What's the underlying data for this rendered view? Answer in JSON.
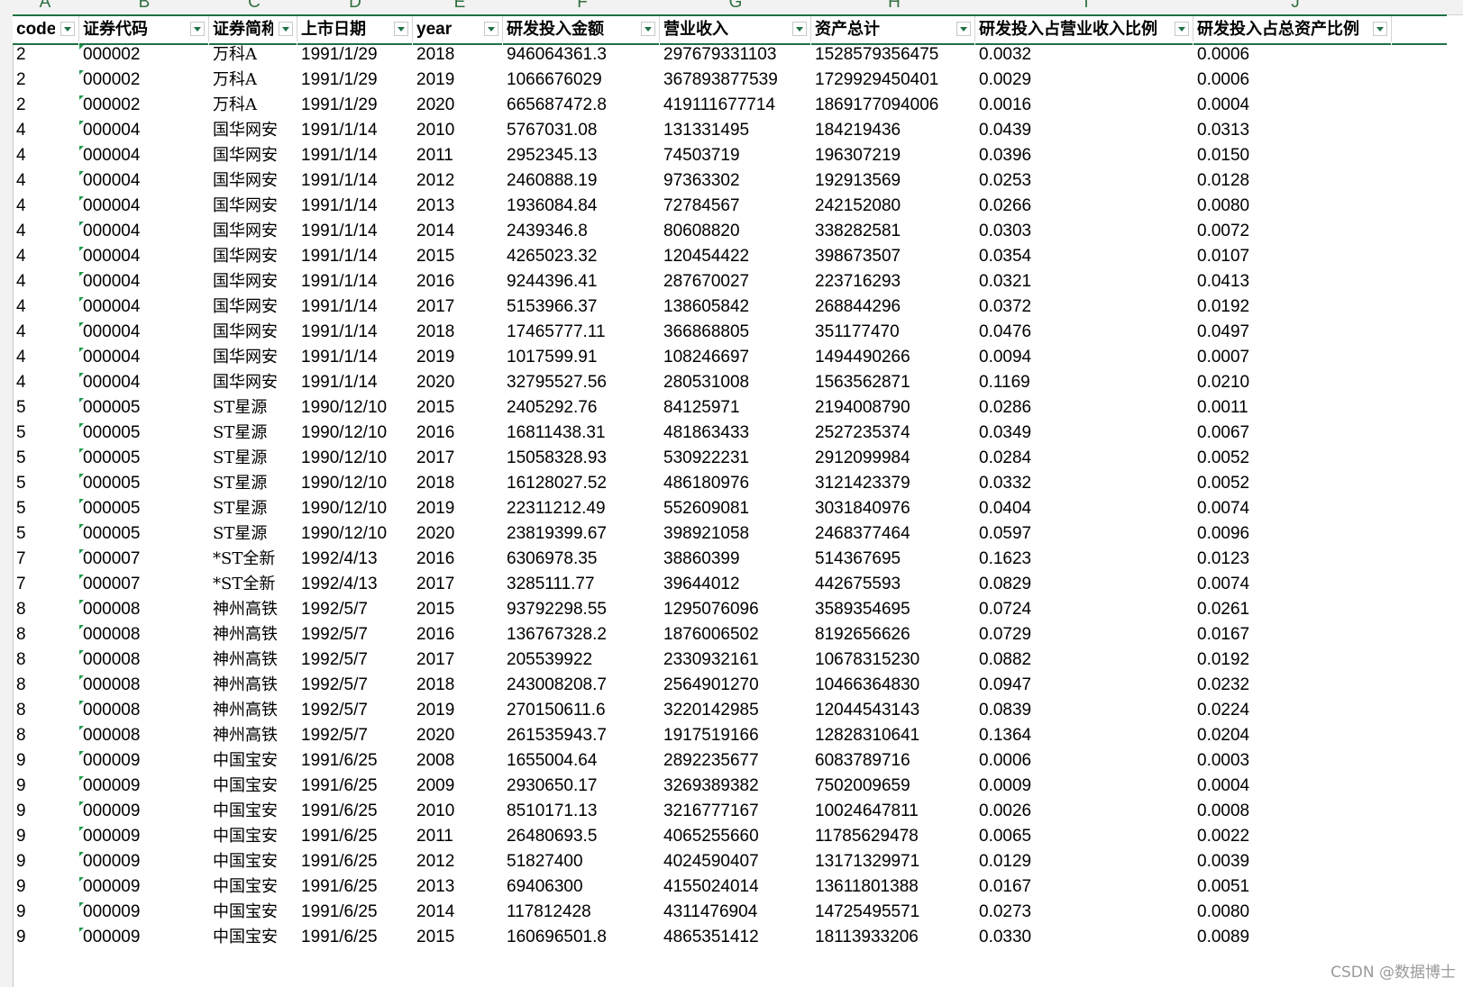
{
  "column_letters": [
    "A",
    "B",
    "C",
    "D",
    "E",
    "F",
    "G",
    "H",
    "I",
    "J"
  ],
  "headers": [
    "code",
    "证券代码",
    "证券简称",
    "上市日期",
    "year",
    "研发投入金额",
    "营业收入",
    "资产总计",
    "研发投入占营业收入比例",
    "研发投入占总资产比例"
  ],
  "rows": [
    [
      "2",
      "000002",
      "万科A",
      "1991/1/29",
      "2018",
      "946064361.3",
      "297679331103",
      "1528579356475",
      "0.0032",
      "0.0006"
    ],
    [
      "2",
      "000002",
      "万科A",
      "1991/1/29",
      "2019",
      "1066676029",
      "367893877539",
      "1729929450401",
      "0.0029",
      "0.0006"
    ],
    [
      "2",
      "000002",
      "万科A",
      "1991/1/29",
      "2020",
      "665687472.8",
      "419111677714",
      "1869177094006",
      "0.0016",
      "0.0004"
    ],
    [
      "4",
      "000004",
      "国华网安",
      "1991/1/14",
      "2010",
      "5767031.08",
      "131331495",
      "184219436",
      "0.0439",
      "0.0313"
    ],
    [
      "4",
      "000004",
      "国华网安",
      "1991/1/14",
      "2011",
      "2952345.13",
      "74503719",
      "196307219",
      "0.0396",
      "0.0150"
    ],
    [
      "4",
      "000004",
      "国华网安",
      "1991/1/14",
      "2012",
      "2460888.19",
      "97363302",
      "192913569",
      "0.0253",
      "0.0128"
    ],
    [
      "4",
      "000004",
      "国华网安",
      "1991/1/14",
      "2013",
      "1936084.84",
      "72784567",
      "242152080",
      "0.0266",
      "0.0080"
    ],
    [
      "4",
      "000004",
      "国华网安",
      "1991/1/14",
      "2014",
      "2439346.8",
      "80608820",
      "338282581",
      "0.0303",
      "0.0072"
    ],
    [
      "4",
      "000004",
      "国华网安",
      "1991/1/14",
      "2015",
      "4265023.32",
      "120454422",
      "398673507",
      "0.0354",
      "0.0107"
    ],
    [
      "4",
      "000004",
      "国华网安",
      "1991/1/14",
      "2016",
      "9244396.41",
      "287670027",
      "223716293",
      "0.0321",
      "0.0413"
    ],
    [
      "4",
      "000004",
      "国华网安",
      "1991/1/14",
      "2017",
      "5153966.37",
      "138605842",
      "268844296",
      "0.0372",
      "0.0192"
    ],
    [
      "4",
      "000004",
      "国华网安",
      "1991/1/14",
      "2018",
      "17465777.11",
      "366868805",
      "351177470",
      "0.0476",
      "0.0497"
    ],
    [
      "4",
      "000004",
      "国华网安",
      "1991/1/14",
      "2019",
      "1017599.91",
      "108246697",
      "1494490266",
      "0.0094",
      "0.0007"
    ],
    [
      "4",
      "000004",
      "国华网安",
      "1991/1/14",
      "2020",
      "32795527.56",
      "280531008",
      "1563562871",
      "0.1169",
      "0.0210"
    ],
    [
      "5",
      "000005",
      "ST星源",
      "1990/12/10",
      "2015",
      "2405292.76",
      "84125971",
      "2194008790",
      "0.0286",
      "0.0011"
    ],
    [
      "5",
      "000005",
      "ST星源",
      "1990/12/10",
      "2016",
      "16811438.31",
      "481863433",
      "2527235374",
      "0.0349",
      "0.0067"
    ],
    [
      "5",
      "000005",
      "ST星源",
      "1990/12/10",
      "2017",
      "15058328.93",
      "530922231",
      "2912099984",
      "0.0284",
      "0.0052"
    ],
    [
      "5",
      "000005",
      "ST星源",
      "1990/12/10",
      "2018",
      "16128027.52",
      "486180976",
      "3121423379",
      "0.0332",
      "0.0052"
    ],
    [
      "5",
      "000005",
      "ST星源",
      "1990/12/10",
      "2019",
      "22311212.49",
      "552609081",
      "3031840976",
      "0.0404",
      "0.0074"
    ],
    [
      "5",
      "000005",
      "ST星源",
      "1990/12/10",
      "2020",
      "23819399.67",
      "398921058",
      "2468377464",
      "0.0597",
      "0.0096"
    ],
    [
      "7",
      "000007",
      "*ST全新",
      "1992/4/13",
      "2016",
      "6306978.35",
      "38860399",
      "514367695",
      "0.1623",
      "0.0123"
    ],
    [
      "7",
      "000007",
      "*ST全新",
      "1992/4/13",
      "2017",
      "3285111.77",
      "39644012",
      "442675593",
      "0.0829",
      "0.0074"
    ],
    [
      "8",
      "000008",
      "神州高铁",
      "1992/5/7",
      "2015",
      "93792298.55",
      "1295076096",
      "3589354695",
      "0.0724",
      "0.0261"
    ],
    [
      "8",
      "000008",
      "神州高铁",
      "1992/5/7",
      "2016",
      "136767328.2",
      "1876006502",
      "8192656626",
      "0.0729",
      "0.0167"
    ],
    [
      "8",
      "000008",
      "神州高铁",
      "1992/5/7",
      "2017",
      "205539922",
      "2330932161",
      "10678315230",
      "0.0882",
      "0.0192"
    ],
    [
      "8",
      "000008",
      "神州高铁",
      "1992/5/7",
      "2018",
      "243008208.7",
      "2564901270",
      "10466364830",
      "0.0947",
      "0.0232"
    ],
    [
      "8",
      "000008",
      "神州高铁",
      "1992/5/7",
      "2019",
      "270150611.6",
      "3220142985",
      "12044543143",
      "0.0839",
      "0.0224"
    ],
    [
      "8",
      "000008",
      "神州高铁",
      "1992/5/7",
      "2020",
      "261535943.7",
      "1917519166",
      "12828310641",
      "0.1364",
      "0.0204"
    ],
    [
      "9",
      "000009",
      "中国宝安",
      "1991/6/25",
      "2008",
      "1655004.64",
      "2892235677",
      "6083789716",
      "0.0006",
      "0.0003"
    ],
    [
      "9",
      "000009",
      "中国宝安",
      "1991/6/25",
      "2009",
      "2930650.17",
      "3269389382",
      "7502009659",
      "0.0009",
      "0.0004"
    ],
    [
      "9",
      "000009",
      "中国宝安",
      "1991/6/25",
      "2010",
      "8510171.13",
      "3216777167",
      "10024647811",
      "0.0026",
      "0.0008"
    ],
    [
      "9",
      "000009",
      "中国宝安",
      "1991/6/25",
      "2011",
      "26480693.5",
      "4065255660",
      "11785629478",
      "0.0065",
      "0.0022"
    ],
    [
      "9",
      "000009",
      "中国宝安",
      "1991/6/25",
      "2012",
      "51827400",
      "4024590407",
      "13171329971",
      "0.0129",
      "0.0039"
    ],
    [
      "9",
      "000009",
      "中国宝安",
      "1991/6/25",
      "2013",
      "69406300",
      "4155024014",
      "13611801388",
      "0.0167",
      "0.0051"
    ],
    [
      "9",
      "000009",
      "中国宝安",
      "1991/6/25",
      "2014",
      "117812428",
      "4311476904",
      "14725495571",
      "0.0273",
      "0.0080"
    ],
    [
      "9",
      "000009",
      "中国宝安",
      "1991/6/25",
      "2015",
      "160696501.8",
      "4865351412",
      "18113933206",
      "0.0330",
      "0.0089"
    ]
  ],
  "watermark": "CSDN @数据博士",
  "colors": {
    "accent": "#1e7145",
    "text_marker": "#1e9a4b",
    "gutter": "#f2f2f2"
  },
  "icons": {
    "filter_button": "filter-dropdown-icon"
  }
}
